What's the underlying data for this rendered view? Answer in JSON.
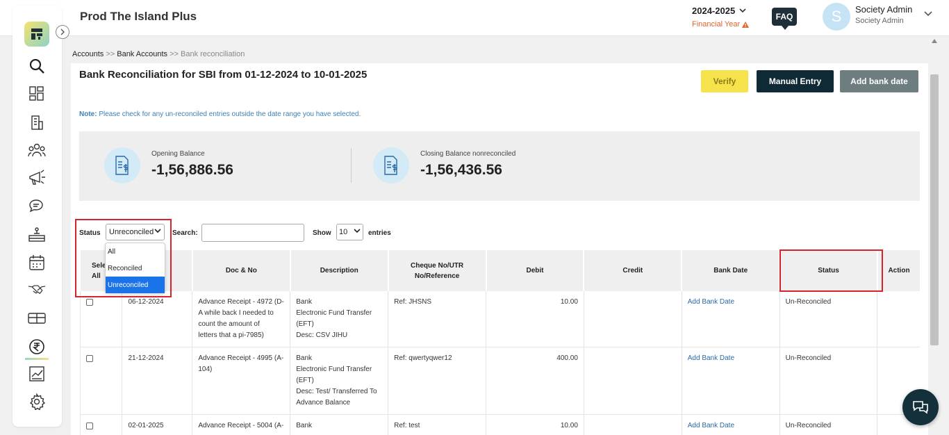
{
  "header": {
    "app_title": "Prod The Island Plus",
    "financial_year": "2024-2025",
    "financial_year_label": "Financial Year",
    "faq_label": "FAQ",
    "user_initial": "S",
    "user_name": "Society Admin",
    "user_role": "Society Admin"
  },
  "breadcrumb": {
    "item1": "Accounts",
    "sep1": ">>",
    "item2": "Bank Accounts",
    "sep2": ">>",
    "item3": "Bank reconciliation"
  },
  "page": {
    "title": "Bank Reconciliation for SBI from 01-12-2024 to 10-01-2025",
    "verify_label": "Verify",
    "manual_entry_label": "Manual Entry",
    "add_bank_date_label": "Add bank date",
    "note_prefix": "Note:",
    "note_text": "Please check for any un-reconciled entries outside the date range you have selected."
  },
  "balances": {
    "opening_label": "Opening Balance",
    "opening_value": "-1,56,886.56",
    "closing_label": "Closing Balance nonreconciled",
    "closing_value": "-1,56,436.56"
  },
  "filters": {
    "status_label": "Status",
    "status_value": "Unreconciled",
    "status_options": [
      "All",
      "Reconciled",
      "Unreconciled"
    ],
    "search_label": "Search:",
    "show_label": "Show",
    "entries_value": "10",
    "entries_label": "entries"
  },
  "table": {
    "headers": {
      "select_all": "Sele",
      "select_all_2": "All",
      "doc_no": "Doc & No",
      "description": "Description",
      "cheque": "Cheque No/UTR",
      "cheque_2": "No/Reference",
      "debit": "Debit",
      "credit": "Credit",
      "bank_date": "Bank Date",
      "status": "Status",
      "action": "Action"
    },
    "rows": [
      {
        "date": "06-12-2024",
        "doc": [
          "Advance Receipt - 4972 (D-",
          "A while back I needed to",
          "count the amount of",
          "letters that a pi-7985)"
        ],
        "desc": [
          "Bank",
          "Electronic Fund Transfer",
          "(EFT)",
          "Desc: CSV JIHU"
        ],
        "ref": "Ref: JHSNS",
        "debit": "10.00",
        "credit": "",
        "bank_date": "Add Bank Date",
        "status": "Un-Reconciled"
      },
      {
        "date": "21-12-2024",
        "doc": [
          "Advance Receipt - 4995 (A-",
          "104)"
        ],
        "desc": [
          "Bank",
          "Electronic Fund Transfer",
          "(EFT)",
          "Desc: Test/ Transferred To",
          "Advance Balance"
        ],
        "ref": "Ref: qwertyqwer12",
        "debit": "400.00",
        "credit": "",
        "bank_date": "Add Bank Date",
        "status": "Un-Reconciled"
      },
      {
        "date": "02-01-2025",
        "doc": [
          "Advance Receipt - 5004 (A-"
        ],
        "desc": [
          "Bank"
        ],
        "ref": "Ref: test",
        "debit": "10.00",
        "credit": "",
        "bank_date": "Add Bank Date",
        "status": "Un-Reconciled"
      }
    ]
  },
  "icons": {
    "sidebar": [
      "search-icon",
      "dashboard-icon",
      "building-icon",
      "members-icon",
      "announcement-icon",
      "chat-icon",
      "facility-icon",
      "calendar-icon",
      "handshake-icon",
      "parcel-icon",
      "rupee-icon",
      "reports-icon",
      "settings-icon"
    ]
  },
  "colors": {
    "verify_bg": "#f6e34c",
    "manual_bg": "#0f2a35",
    "addbank_bg": "#6d7d80",
    "link": "#2b6aa6",
    "highlight_red": "#d9232a"
  }
}
